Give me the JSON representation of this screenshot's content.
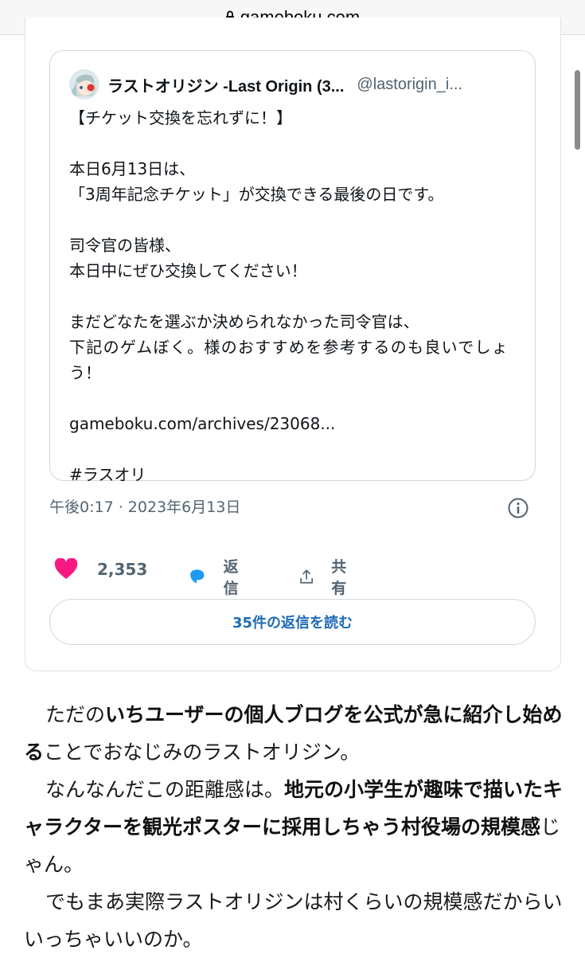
{
  "browser": {
    "url": "gameboku.com"
  },
  "tweet": {
    "author_name": "ラストオリジン -Last Origin (3...",
    "author_handle": "@lastorigin_i...",
    "lines": [
      "【チケット交換を忘れずに！】",
      "",
      "本日6月13日は、",
      "「3周年記念チケット」が交換できる最後の日です。",
      "",
      "司令官の皆様、",
      "本日中にぜひ交換してください！",
      "",
      "まだどなたを選ぶか決められなかった司令官は、",
      "下記のゲムぼく。様のおすすめを参考するのも良いでしょ",
      "う！",
      "",
      "gameboku.com/archives/23068...",
      "",
      "#ラスオリ"
    ],
    "timestamp": "午後0:17 · 2023年6月13日",
    "like_count": "2,353",
    "reply_label": "返信",
    "share_label": "共有",
    "read_replies_label": "35件の返信を読む"
  },
  "article": {
    "p1": {
      "a": "ただの",
      "b": "いちユーザーの個人ブログを公式が急に紹介し始める",
      "c": "ことでおなじみのラストオリジン。"
    },
    "p2": {
      "a": "なんなんだこの距離感は。",
      "b": "地元の小学生が趣味で描いたキャラクターを観光ポスターに採用しちゃう村役場の規模感",
      "c": "じゃん。"
    },
    "p3": "でもまあ実際ラストオリジンは村くらいの規模感だからいいっちゃいいのか。"
  },
  "colors": {
    "heart": "#f91880",
    "reply_bubble": "#1d9bf0",
    "link_blue": "#1d6bb5",
    "muted": "#536471"
  }
}
